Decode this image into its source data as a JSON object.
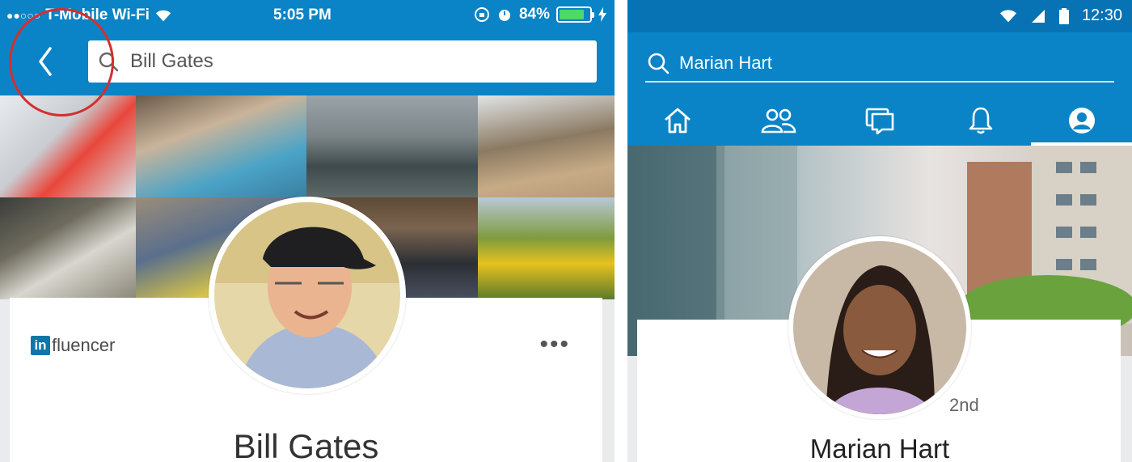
{
  "left_screen": {
    "status_bar": {
      "carrier": "T-Mobile Wi-Fi",
      "time": "5:05 PM",
      "battery_percent": "84%",
      "battery_level": 0.84,
      "icons": [
        "signal-dots-icon",
        "wifi-icon",
        "orientation-lock-icon",
        "alarm-icon",
        "battery-icon",
        "charging-bolt-icon"
      ]
    },
    "navbar": {
      "back_icon": "chevron-left-icon",
      "search_icon": "search-icon",
      "search_value": "Bill Gates"
    },
    "profile": {
      "badge_in": "in",
      "badge_text": "fluencer",
      "more_label": "•••",
      "name": "Bill Gates"
    },
    "colors": {
      "brand_blue": "#0a84c6",
      "highlight_circle": "#d32f2f",
      "battery_green": "#4cd964"
    }
  },
  "right_screen": {
    "status_bar": {
      "time": "12:30",
      "icons": [
        "wifi-icon",
        "cell-signal-icon",
        "battery-icon"
      ]
    },
    "search": {
      "search_icon": "search-icon",
      "value": "Marian Hart"
    },
    "tabs": [
      {
        "icon": "home-icon",
        "active": false
      },
      {
        "icon": "my-network-icon",
        "active": false
      },
      {
        "icon": "messaging-icon",
        "active": false
      },
      {
        "icon": "notifications-icon",
        "active": false
      },
      {
        "icon": "profile-icon",
        "active": true
      }
    ],
    "profile": {
      "degree": "2nd",
      "name": "Marian Hart"
    },
    "colors": {
      "status_blue": "#0873b4",
      "brand_blue": "#0a84c6"
    }
  }
}
